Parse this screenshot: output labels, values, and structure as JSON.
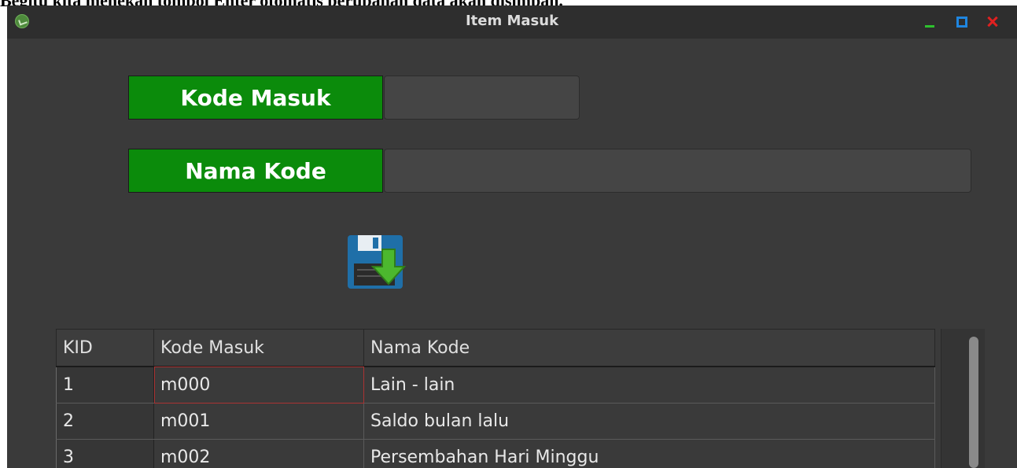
{
  "caption": "Begitu kita menekan tombol Enter otomatis perubahan data akan disimpan.",
  "window": {
    "title": "Item Masuk"
  },
  "form": {
    "kode_masuk_label": "Kode Masuk",
    "kode_masuk_value": "",
    "nama_kode_label": "Nama Kode",
    "nama_kode_value": ""
  },
  "table": {
    "headers": [
      "KID",
      "Kode Masuk",
      "Nama Kode"
    ],
    "rows": [
      {
        "kid": "1",
        "kode": "m000",
        "nama": "Lain - lain"
      },
      {
        "kid": "2",
        "kode": "m001",
        "nama": "Saldo bulan lalu"
      },
      {
        "kid": "3",
        "kode": "m002",
        "nama": "Persembahan Hari Minggu"
      }
    ]
  },
  "icons": {
    "app": "app-icon",
    "minimize": "minimize-icon",
    "maximize": "maximize-icon",
    "close": "close-icon",
    "save": "save-icon"
  },
  "colors": {
    "label_green": "#0b8b0b",
    "window_bg": "#3a3a3a",
    "close_red": "#e02020",
    "maximize_blue": "#1f86e0",
    "minimize_green": "#2ec22e"
  }
}
